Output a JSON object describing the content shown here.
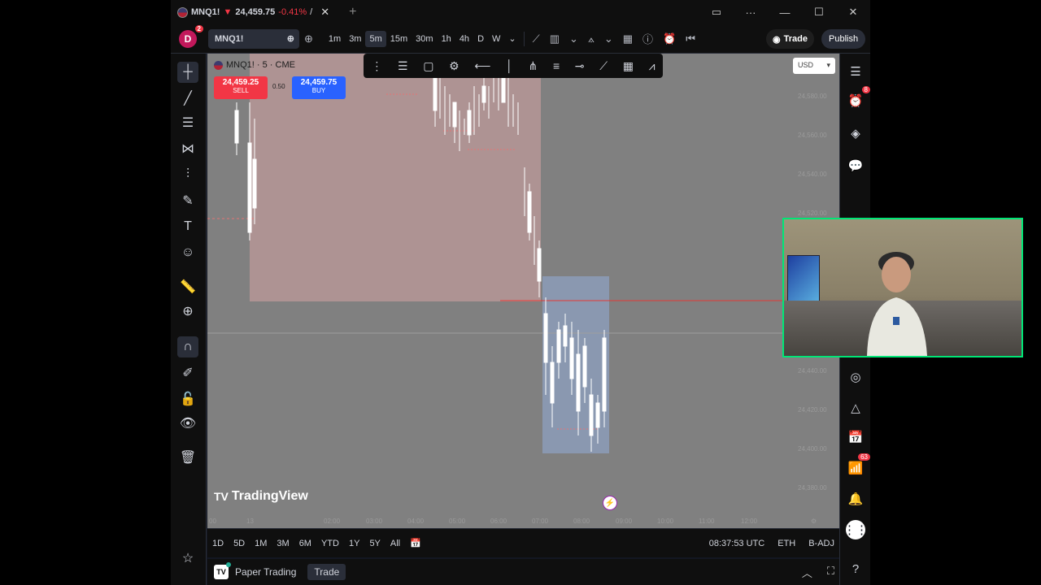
{
  "window": {
    "tab": {
      "symbol": "MNQ1!",
      "price": "24,459.75",
      "change": "-0.41%",
      "extra": "/"
    },
    "controls": [
      "minimize",
      "maximize",
      "close"
    ]
  },
  "toolbar": {
    "avatar_letter": "D",
    "avatar_badge": "2",
    "symbol": "MNQ1!",
    "intervals": [
      "1m",
      "3m",
      "5m",
      "15m",
      "30m",
      "1h",
      "4h",
      "D",
      "W"
    ],
    "active_interval": "5m",
    "trade_label": "Trade",
    "publish_label": "Publish"
  },
  "chart": {
    "legend_symbol": "MNQ1! · 5 · CME",
    "sell_price": "24,459.25",
    "sell_label": "SELL",
    "spread": "0.50",
    "buy_price": "24,459.75",
    "buy_label": "BUY",
    "currency": "USD",
    "logo_text": "TradingView",
    "price_labels": [
      "24,580.00",
      "24,560.00",
      "24,540.00",
      "24,520.00",
      "24,440.00",
      "24,420.00",
      "24,400.00",
      "24,380.00"
    ],
    "time_labels": [
      "00",
      "13",
      "02:00",
      "03:00",
      "04:00",
      "05:00",
      "06:00",
      "07:00",
      "08:00",
      "09:00",
      "10:00",
      "11:00",
      "12:00"
    ]
  },
  "ranges": {
    "items": [
      "1D",
      "5D",
      "1M",
      "3M",
      "6M",
      "YTD",
      "1Y",
      "5Y",
      "All"
    ],
    "clock": "08:37:53 UTC",
    "session": "ETH",
    "adjust": "B-ADJ"
  },
  "bottom": {
    "paper_trading": "Paper Trading",
    "trade": "Trade"
  },
  "rightbar": {
    "alerts_badge": "8",
    "news_badge": "63"
  }
}
